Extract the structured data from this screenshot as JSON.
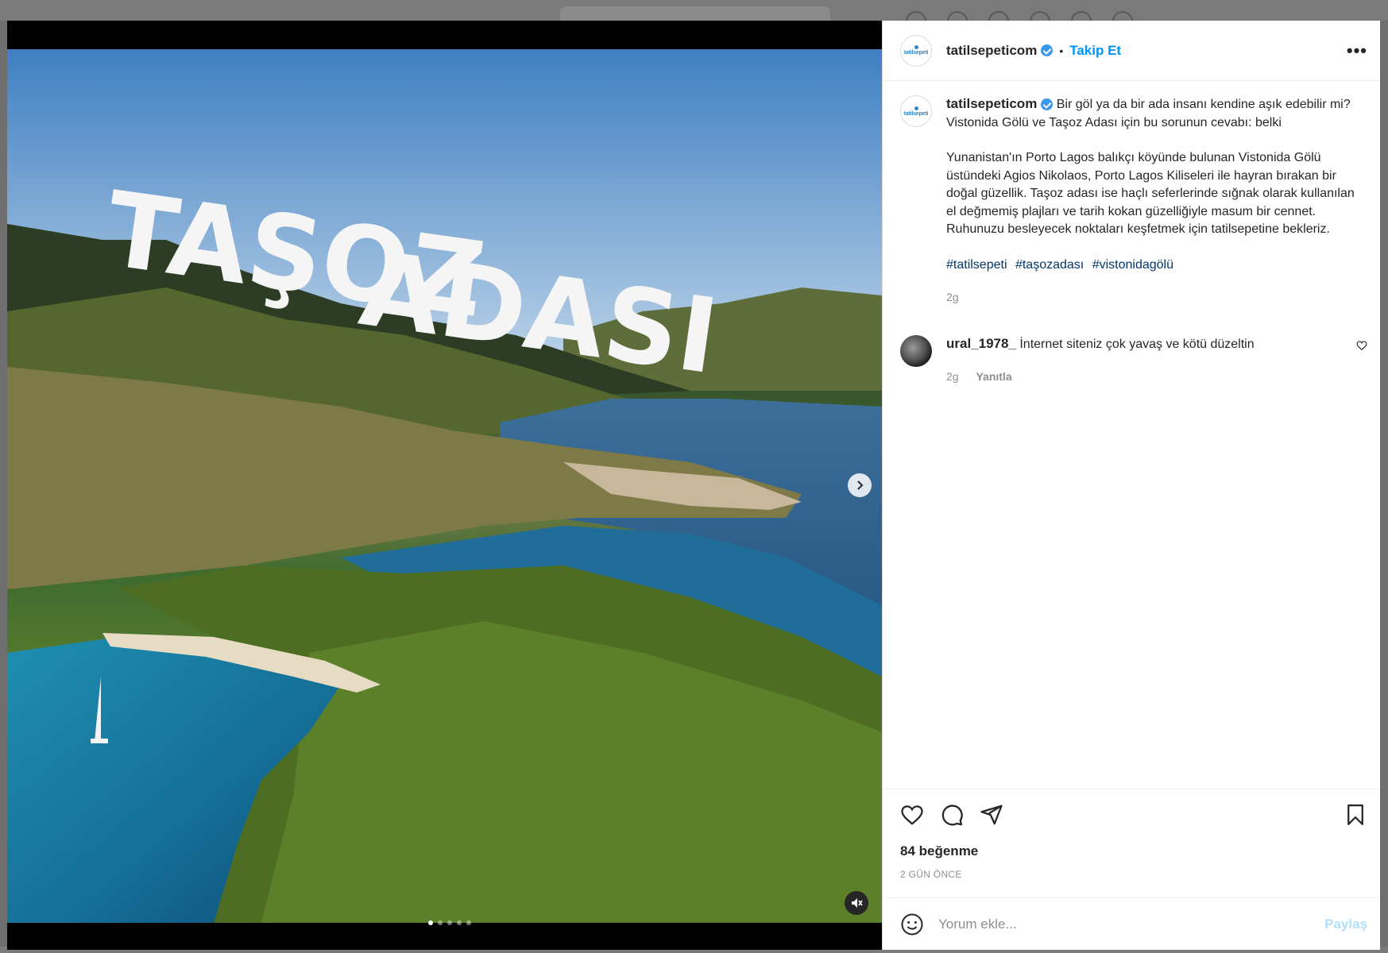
{
  "post": {
    "username": "tatilsepeticom",
    "follow_label": "Takip Et",
    "separator": "•",
    "more_label": "•••",
    "avatar_text": "tatilsepeti"
  },
  "media": {
    "overlay_text": "TAŞOZ ADASI",
    "slide_count": 5,
    "active_slide": 1
  },
  "caption": {
    "username": "tatilsepeticom",
    "line1": "Bir göl ya da bir ada insanı kendine aşık edebilir mi? Vistonida Gölü ve Taşoz Adası için bu sorunun cevabı: belki",
    "para2": "Yunanistan'ın Porto Lagos balıkçı köyünde bulunan Vistonida Gölü üstündeki Agios Nikolaos, Porto Lagos Kiliseleri ile hayran bırakan bir doğal güzellik. Taşoz adası ise haçlı seferlerinde sığnak olarak kullanılan el değmemiş plajları ve tarih kokan güzelliğiyle masum bir cennet. Ruhunuzu besleyecek noktaları keşfetmek için tatilsepetine bekleriz.",
    "hashtags": [
      "#tatilsepeti",
      "#taşozadası",
      "#vistonidagölü"
    ],
    "time": "2g"
  },
  "comments": [
    {
      "username": "ural_1978_",
      "text": "İnternet siteniz çok yavaş ve kötü düzeltin",
      "time": "2g",
      "reply_label": "Yanıtla"
    }
  ],
  "stats": {
    "likes": "84 beğenme",
    "posted": "2 GÜN ÖNCE"
  },
  "composer": {
    "placeholder": "Yorum ekle...",
    "post_label": "Paylaş"
  },
  "colors": {
    "accent": "#0095f6",
    "hashtag": "#00376b",
    "muted": "#8e8e8e",
    "post_disabled": "#b2dffc"
  }
}
